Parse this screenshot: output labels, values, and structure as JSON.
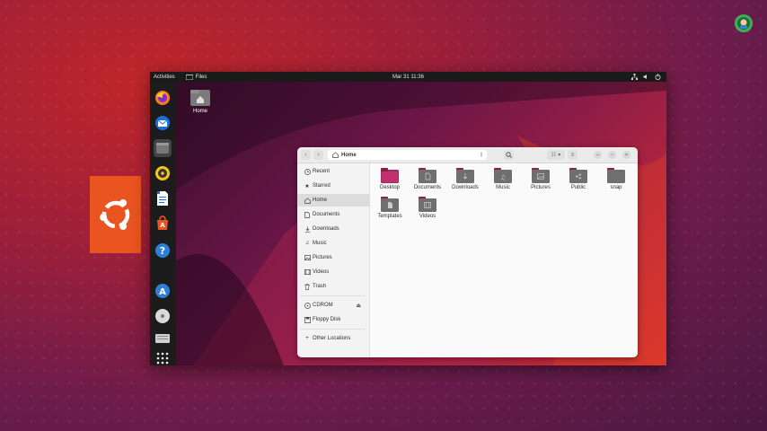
{
  "topbar": {
    "activities": "Activities",
    "app": "Files",
    "clock": "Mar 31  11:36"
  },
  "desktop": {
    "home_label": "Home"
  },
  "window": {
    "path": "Home"
  },
  "sidebar": {
    "items": [
      {
        "label": "Recent",
        "icon": "clock-icon"
      },
      {
        "label": "Starred",
        "icon": "star-icon"
      },
      {
        "label": "Home",
        "icon": "home-icon"
      },
      {
        "label": "Documents",
        "icon": "document-icon"
      },
      {
        "label": "Downloads",
        "icon": "download-icon"
      },
      {
        "label": "Music",
        "icon": "music-icon"
      },
      {
        "label": "Pictures",
        "icon": "image-icon"
      },
      {
        "label": "Videos",
        "icon": "video-icon"
      },
      {
        "label": "Trash",
        "icon": "trash-icon"
      }
    ],
    "devices": [
      {
        "label": "CDROM",
        "icon": "disc-icon"
      },
      {
        "label": "Floppy Disk",
        "icon": "floppy-icon"
      }
    ],
    "other": {
      "label": "Other Locations",
      "icon": "plus-icon"
    }
  },
  "folders": [
    {
      "label": "Desktop"
    },
    {
      "label": "Documents"
    },
    {
      "label": "Downloads"
    },
    {
      "label": "Music"
    },
    {
      "label": "Pictures"
    },
    {
      "label": "Public"
    },
    {
      "label": "snap"
    },
    {
      "label": "Templates"
    },
    {
      "label": "Videos"
    }
  ],
  "colors": {
    "ubuntu_orange": "#e95420",
    "folder": "#6f6f6f",
    "folder_tab": "#8a2140"
  }
}
